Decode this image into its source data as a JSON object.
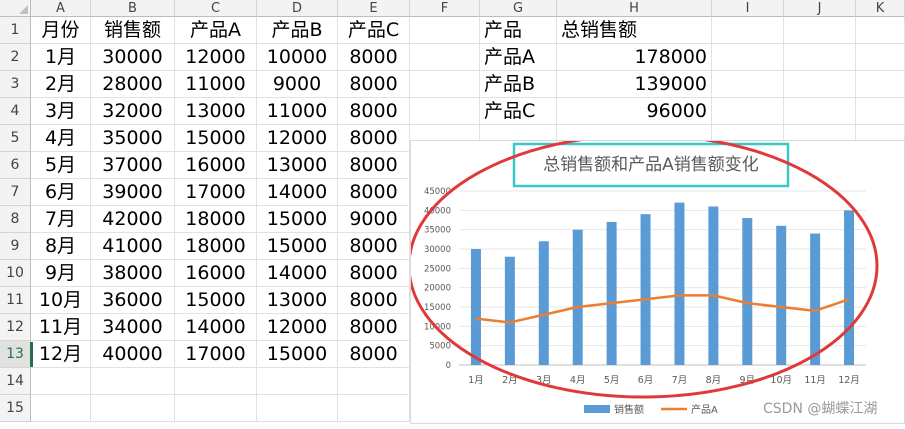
{
  "columns": [
    "A",
    "B",
    "C",
    "D",
    "E",
    "F",
    "G",
    "H",
    "I",
    "J",
    "K"
  ],
  "rows": [
    "1",
    "2",
    "3",
    "4",
    "5",
    "6",
    "7",
    "8",
    "9",
    "10",
    "11",
    "12",
    "13",
    "14",
    "15"
  ],
  "header_row": [
    "月份",
    "销售额",
    "产品A",
    "产品B",
    "产品C"
  ],
  "data_rows": [
    [
      "1月",
      "30000",
      "12000",
      "10000",
      "8000"
    ],
    [
      "2月",
      "28000",
      "11000",
      "9000",
      "8000"
    ],
    [
      "3月",
      "32000",
      "13000",
      "11000",
      "8000"
    ],
    [
      "4月",
      "35000",
      "15000",
      "12000",
      "8000"
    ],
    [
      "5月",
      "37000",
      "16000",
      "13000",
      "8000"
    ],
    [
      "6月",
      "39000",
      "17000",
      "14000",
      "8000"
    ],
    [
      "7月",
      "42000",
      "18000",
      "15000",
      "9000"
    ],
    [
      "8月",
      "41000",
      "18000",
      "15000",
      "8000"
    ],
    [
      "9月",
      "38000",
      "16000",
      "14000",
      "8000"
    ],
    [
      "10月",
      "36000",
      "15000",
      "13000",
      "8000"
    ],
    [
      "11月",
      "34000",
      "14000",
      "12000",
      "8000"
    ],
    [
      "12月",
      "40000",
      "17000",
      "15000",
      "8000"
    ]
  ],
  "summary": {
    "header": [
      "产品",
      "总销售额"
    ],
    "rows": [
      [
        "产品A",
        "178000"
      ],
      [
        "产品B",
        "139000"
      ],
      [
        "产品C",
        "96000"
      ]
    ]
  },
  "selected_row": "13",
  "chart_data": {
    "type": "bar",
    "title": "总销售额和产品A销售额变化",
    "categories": [
      "1月",
      "2月",
      "3月",
      "4月",
      "5月",
      "6月",
      "7月",
      "8月",
      "9月",
      "10月",
      "11月",
      "12月"
    ],
    "series": [
      {
        "name": "销售额",
        "type": "bar",
        "color": "#5b9bd5",
        "values": [
          30000,
          28000,
          32000,
          35000,
          37000,
          39000,
          42000,
          41000,
          38000,
          36000,
          34000,
          40000
        ]
      },
      {
        "name": "产品A",
        "type": "line",
        "color": "#ed7d31",
        "values": [
          12000,
          11000,
          13000,
          15000,
          16000,
          17000,
          18000,
          18000,
          16000,
          15000,
          14000,
          17000
        ]
      }
    ],
    "yticks": [
      "0",
      "5000",
      "10000",
      "15000",
      "20000",
      "25000",
      "30000",
      "35000",
      "40000",
      "45000"
    ],
    "ylim": [
      0,
      45000
    ],
    "legend": "bottom",
    "title_box_color": "#3cc7c7",
    "annotation_color": "#e0393b"
  },
  "watermark": "CSDN @蝴蝶江湖"
}
